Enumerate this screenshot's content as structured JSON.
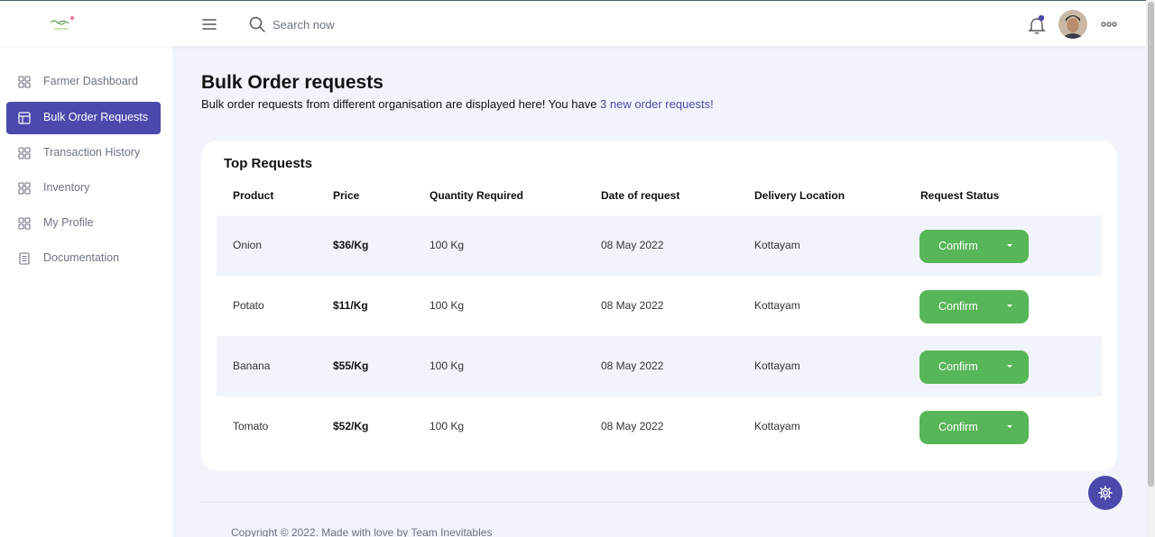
{
  "header": {
    "search": {
      "placeholder": "Search now"
    },
    "icons": {
      "menu": "hamburger-icon",
      "search": "search-icon",
      "notifications": "bell-icon",
      "more": "more-horizontal-icon"
    }
  },
  "sidebar": {
    "items": [
      {
        "label": "Farmer Dashboard",
        "icon": "grid-icon"
      },
      {
        "label": "Bulk Order Requests",
        "icon": "layout-icon",
        "active": true
      },
      {
        "label": "Transaction History",
        "icon": "grid-icon"
      },
      {
        "label": "Inventory",
        "icon": "grid-icon"
      },
      {
        "label": "My Profile",
        "icon": "grid-icon"
      },
      {
        "label": "Documentation",
        "icon": "document-icon"
      }
    ]
  },
  "main": {
    "title": "Bulk Order requests",
    "subtitle_prefix": "Bulk order requests from different organisation are displayed here! You have ",
    "subtitle_highlight": "3 new order requests!",
    "card": {
      "title": "Top Requests",
      "columns": [
        "Product",
        "Price",
        "Quantity Required",
        "Date of request",
        "Delivery Location",
        "Request Status"
      ],
      "rows": [
        {
          "product": "Onion",
          "price": "$36/Kg",
          "quantity": "100 Kg",
          "date": "08 May 2022",
          "location": "Kottayam",
          "status": "Confirm"
        },
        {
          "product": "Potato",
          "price": "$11/Kg",
          "quantity": "100 Kg",
          "date": "08 May 2022",
          "location": "Kottayam",
          "status": "Confirm"
        },
        {
          "product": "Banana",
          "price": "$55/Kg",
          "quantity": "100 Kg",
          "date": "08 May 2022",
          "location": "Kottayam",
          "status": "Confirm"
        },
        {
          "product": "Tomato",
          "price": "$52/Kg",
          "quantity": "100 Kg",
          "date": "08 May 2022",
          "location": "Kottayam",
          "status": "Confirm"
        }
      ]
    }
  },
  "footer": {
    "text": "Copyright © 2022. Made with love by Team Inevitables"
  },
  "colors": {
    "primary": "#4b49ac",
    "success": "#57b657",
    "background": "#f1f4fb",
    "row_alt": "#f2f4fb"
  }
}
